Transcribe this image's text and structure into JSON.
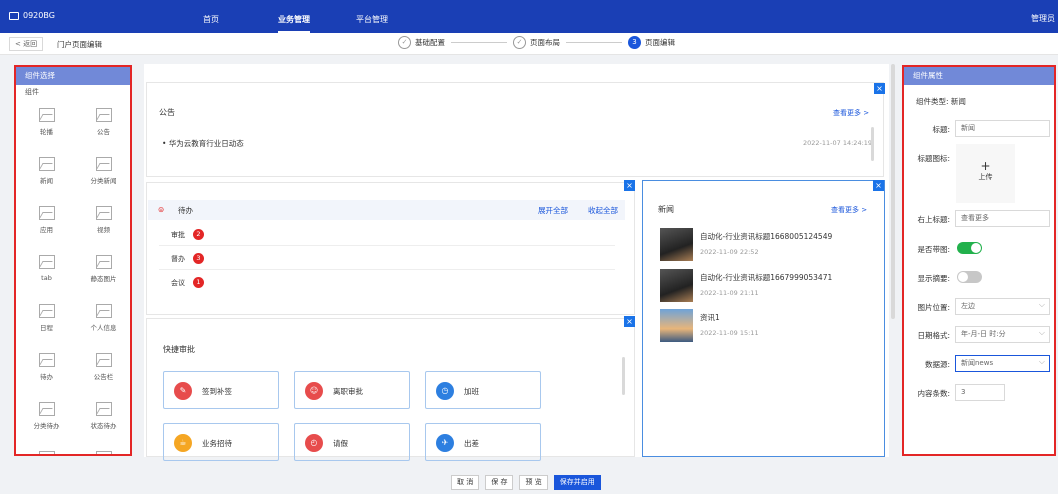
{
  "app": {
    "title": "0920BG",
    "user": "管理员"
  },
  "nav": [
    {
      "label": "首页"
    },
    {
      "label": "业务管理"
    },
    {
      "label": "平台管理"
    }
  ],
  "subbar": {
    "back": "< 返回",
    "crumb": "门户页面编辑"
  },
  "steps": [
    {
      "label": "基础配置",
      "mark": "✓"
    },
    {
      "label": "页面布局",
      "mark": "✓"
    },
    {
      "label": "页面编辑",
      "mark": "3"
    }
  ],
  "left": {
    "title": "组件选择",
    "group": "组件",
    "components": [
      "轮播",
      "公告",
      "新闻",
      "分类新闻",
      "应用",
      "视频",
      "tab",
      "静态图片",
      "日程",
      "个人信息",
      "待办",
      "公告栏",
      "分类待办",
      "状态待办",
      "",
      ""
    ]
  },
  "notice": {
    "title": "公告",
    "more": "查看更多 >",
    "items": [
      {
        "text": "华为云教育行业日动态",
        "date": "2022-11-07 14:24:19"
      }
    ]
  },
  "todo": {
    "title": "待办",
    "expand": "展开全部",
    "collapse": "收起全部",
    "rows": [
      {
        "label": "审批",
        "count": "2"
      },
      {
        "label": "督办",
        "count": "3"
      },
      {
        "label": "会议",
        "count": "1"
      }
    ]
  },
  "quick": {
    "title": "快捷审批",
    "buttons": [
      {
        "label": "签到补签",
        "color": "#e74c4c",
        "icon": "sign-icon"
      },
      {
        "label": "离职审批",
        "color": "#e74c4c",
        "icon": "user-leave-icon"
      },
      {
        "label": "加班",
        "color": "#2d7fe0",
        "icon": "clock-plus-icon"
      },
      {
        "label": "业务招待",
        "color": "#f5a623",
        "icon": "cup-icon"
      },
      {
        "label": "请假",
        "color": "#e74c4c",
        "icon": "clock-icon"
      },
      {
        "label": "出差",
        "color": "#2d7fe0",
        "icon": "plane-icon"
      }
    ]
  },
  "news": {
    "title": "新闻",
    "more": "查看更多 >",
    "items": [
      {
        "title": "自动化-行业资讯标题1668005124549",
        "date": "2022-11-09 22:52"
      },
      {
        "title": "自动化-行业资讯标题1667999053471",
        "date": "2022-11-09 21:11"
      },
      {
        "title": "资讯1",
        "date": "2022-11-09 15:11"
      }
    ]
  },
  "props": {
    "title": "组件属性",
    "type_label": "组件类型:",
    "type_value": "新闻",
    "title_label": "标题:",
    "title_value": "新闻",
    "icon_label": "标题图标:",
    "upload": "上传",
    "right_label": "右上标题:",
    "right_value": "查看更多",
    "showimg_label": "是否带图:",
    "showsum_label": "显示摘要:",
    "pos_label": "图片位置:",
    "pos_value": "左边",
    "datefmt_label": "日期格式:",
    "datefmt_value": "年-月-日 时:分",
    "source_label": "数据源:",
    "source_value": "新闻news",
    "count_label": "内容条数:",
    "count_value": "3"
  },
  "footer": {
    "cancel": "取 消",
    "save": "保 存",
    "preview": "预 览",
    "publish": "保存并启用"
  },
  "colors": {
    "topbar": "#1a3fb5",
    "primary": "#1a56db",
    "highlight": "#e32626",
    "toggle_on": "#22b14c"
  }
}
